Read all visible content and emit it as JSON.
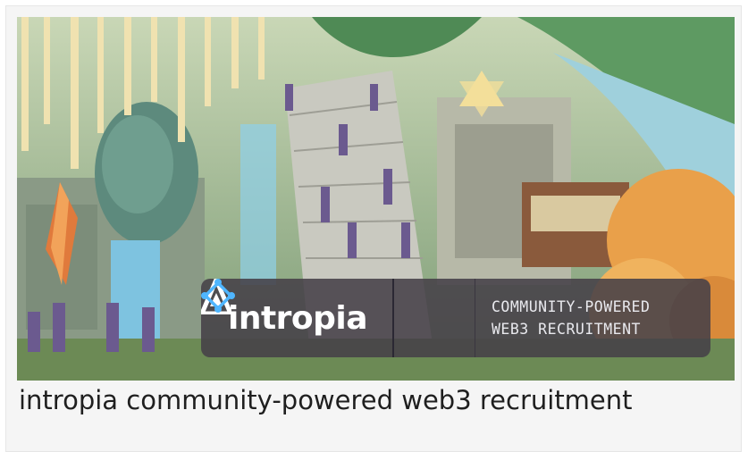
{
  "banner": {
    "brand_name": "intropia",
    "tagline_line1": "COMMUNITY-POWERED",
    "tagline_line2": "WEB3 RECRUITMENT",
    "colors": {
      "overlay": "#464048",
      "chain_icon": "#4fb6ff",
      "brand_text": "#ffffff"
    },
    "icons": [
      "intropia-logo-icon",
      "chain-link-icon"
    ]
  },
  "caption": "intropia community-powered web3 recruitment"
}
